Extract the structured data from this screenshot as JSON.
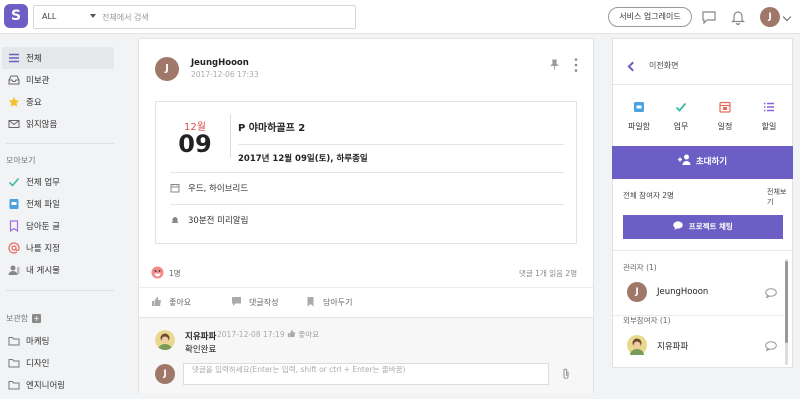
{
  "header": {
    "logo_icon": "app-logo-icon",
    "search": {
      "scope": "ALL",
      "placeholder": "전체에서 검색"
    },
    "upgrade_label": "서비스 업그레이드",
    "avatar_initial": "J"
  },
  "sidebar": {
    "items": [
      {
        "label": "전체",
        "icon": "list-icon"
      },
      {
        "label": "미보관",
        "icon": "inbox-icon"
      },
      {
        "label": "중요",
        "icon": "star-icon"
      },
      {
        "label": "읽지않음",
        "icon": "mail-icon"
      }
    ],
    "section_title": "모아보기",
    "collect_items": [
      {
        "label": "전체 업무",
        "icon": "check-icon"
      },
      {
        "label": "전체 파일",
        "icon": "file-icon"
      },
      {
        "label": "담아둔 글",
        "icon": "bookmark-icon"
      },
      {
        "label": "나를 지정",
        "icon": "at-icon"
      },
      {
        "label": "내 게시물",
        "icon": "person-icon"
      }
    ],
    "storage_title": "보관함",
    "folders": [
      {
        "label": "마케팅"
      },
      {
        "label": "디자인"
      },
      {
        "label": "엔지니어링"
      }
    ]
  },
  "post": {
    "avatar_initial": "J",
    "author": "JeungHooon",
    "date": "2017-12-06 17:33",
    "event": {
      "month": "12월",
      "day": "09",
      "title": "P 야마하골프 2",
      "when": "2017년 12월 09일(토), 하루종일",
      "location": "우드, 하이브리드",
      "reminder": "30분전 미리알림"
    },
    "reaction_count": "1명",
    "reply_stats": "댓글 1개  읽음 2명",
    "actions": {
      "like": "좋아요",
      "comment": "댓글작성",
      "save": "담아두기"
    },
    "comment": {
      "author": "지유파파",
      "time": "2017-12-08 17:19",
      "like": "좋아요",
      "text": "확인완료"
    },
    "comment_input": {
      "avatar_initial": "J",
      "placeholder": "댓글을 입력하세요(Enter는 입력, shift or ctrl + Enter는 줄바꿈)"
    }
  },
  "right_panel": {
    "back_label": "이전화면",
    "quick": [
      {
        "label": "파일함",
        "icon": "file-box-icon"
      },
      {
        "label": "업무",
        "icon": "task-check-icon"
      },
      {
        "label": "일정",
        "icon": "calendar-icon"
      },
      {
        "label": "할일",
        "icon": "todo-list-icon"
      }
    ],
    "invite_label": "초대하기",
    "members_title": "전체 참여자 2명",
    "members_all": "전체보기",
    "chat_label": "프로젝트 채팅",
    "admin_group": "관리자 (1)",
    "admin_member": {
      "initial": "J",
      "name": "JeungHooon"
    },
    "external_group": "외부참여자 (1)",
    "external_member": {
      "name": "지유파파"
    }
  },
  "colors": {
    "brand": "#6c5ec4",
    "accent_red": "#d9534f",
    "check_green": "#3fb9a8"
  }
}
